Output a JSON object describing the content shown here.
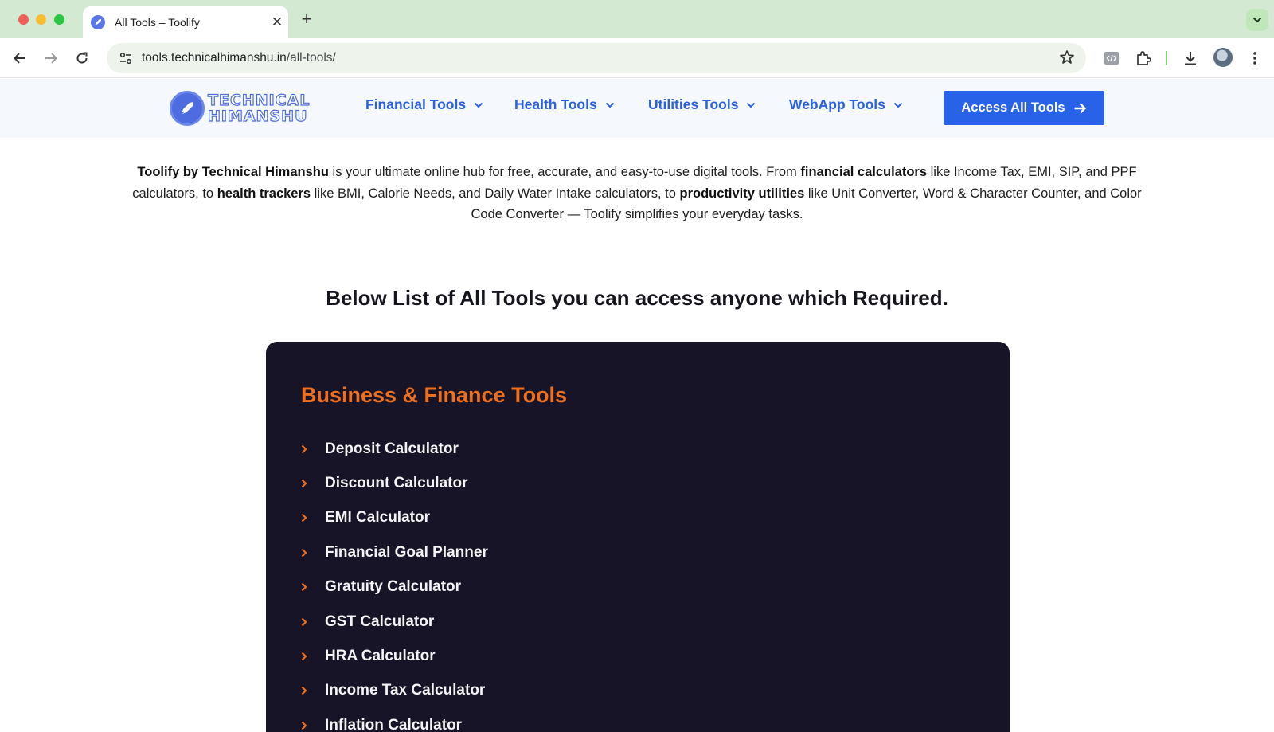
{
  "browser": {
    "tab_title": "All Tools – Toolify",
    "tab_close": "✕",
    "new_tab": "+",
    "url_host": "tools.technicalhimanshu.in",
    "url_path": "/all-tools/"
  },
  "site": {
    "logo_line1": "TECHNICAL",
    "logo_line2": "HIMANSHU",
    "nav": {
      "financial": "Financial Tools",
      "health": "Health Tools",
      "utilities": "Utilities Tools",
      "webapp": "WebApp Tools"
    },
    "cta_label": "Access All Tools"
  },
  "intro": {
    "brand": "Toolify by Technical Himanshu",
    "t1": " is your ultimate online hub for free, accurate, and easy-to-use digital tools. From ",
    "b1": "financial calculators",
    "t2": " like Income Tax, EMI, SIP, and PPF calculators, to ",
    "b2": "health trackers",
    "t3": " like BMI, Calorie Needs, and Daily Water Intake calculators, to ",
    "b3": "productivity utilities",
    "t4": " like Unit Converter, Word & Character Counter, and Color Code Converter — Toolify simplifies your everyday tasks."
  },
  "headline": "Below List of All Tools you can access anyone which Required.",
  "card": {
    "title": "Business & Finance Tools",
    "tools": [
      "Deposit Calculator",
      "Discount Calculator",
      "EMI Calculator",
      "Financial Goal Planner",
      "Gratuity Calculator",
      "GST Calculator",
      "HRA Calculator",
      "Income Tax Calculator",
      "Inflation Calculator"
    ]
  },
  "colors": {
    "brand_blue": "#2762e8",
    "accent_orange": "#ef6f1d",
    "card_bg": "#171427"
  }
}
